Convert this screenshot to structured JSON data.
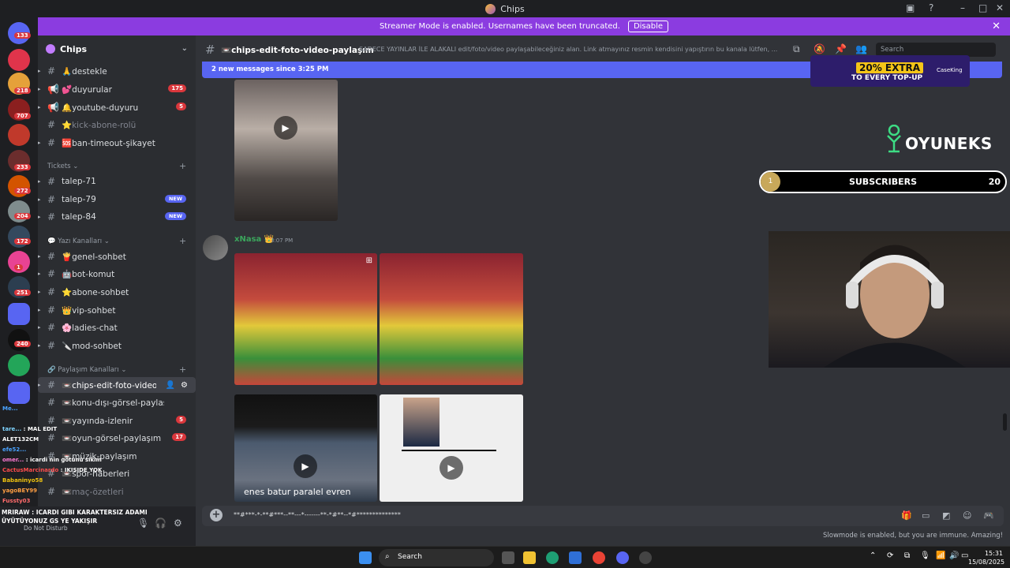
{
  "window": {
    "title": "Chips"
  },
  "banner": {
    "text": "Streamer Mode is enabled. Usernames have been truncated.",
    "button": "Disable",
    "color": "#8b3ce0"
  },
  "rail": {
    "badges": [
      "133",
      "218",
      "707",
      "233",
      "272",
      "204",
      "172",
      "1",
      "251",
      "240"
    ]
  },
  "server": {
    "name": "Chips"
  },
  "channels": [
    {
      "name": "🙏destekle",
      "badge": ""
    },
    {
      "name": "💕duyurular",
      "badge": "175"
    },
    {
      "name": "🔔youtube-duyuru",
      "badge": "5"
    },
    {
      "name": "⭐kick-abone-rolü",
      "badge": ""
    },
    {
      "name": "🆘ban-timeout-şikayet",
      "badge": ""
    }
  ],
  "categories": {
    "tickets": "Tickets",
    "yazi": "Yazı Kanalları",
    "paylasim": "Paylaşım Kanalları"
  },
  "tickets": [
    {
      "name": "talep-71",
      "badge": ""
    },
    {
      "name": "talep-79",
      "badge": "NEW"
    },
    {
      "name": "talep-84",
      "badge": "NEW"
    }
  ],
  "yazi_channels": [
    {
      "name": "🍟genel-sohbet"
    },
    {
      "name": "🤖bot-komut"
    },
    {
      "name": "⭐abone-sohbet"
    },
    {
      "name": "👑vip-sohbet"
    },
    {
      "name": "🌸ladies-chat"
    },
    {
      "name": "🔪mod-sohbet"
    }
  ],
  "paylasim_channels": [
    {
      "name": "📼chips-edit-foto-video-...",
      "badge": ""
    },
    {
      "name": "📼konu-dışı-görsel-paylaşım",
      "badge": ""
    },
    {
      "name": "📼yayında-izlenir",
      "badge": "5"
    },
    {
      "name": "📼oyun-görsel-paylaşım",
      "badge": "17"
    },
    {
      "name": "📼müzik-paylaşım",
      "badge": ""
    },
    {
      "name": "📼spor-haberleri",
      "badge": ""
    },
    {
      "name": "📼maç-özetleri",
      "badge": ""
    }
  ],
  "stream_chat": [
    {
      "user": "Me...",
      "text": ""
    },
    {
      "user": "tare...",
      "text": "MAL EDIT"
    },
    {
      "user": "ALET132CM",
      "text": ""
    },
    {
      "user": "efe52...",
      "text": ""
    },
    {
      "user": "omer...",
      "text": "icardi nin götünü sikim"
    },
    {
      "user": "CactusMarcinardo",
      "text": "IKISIDE YOK"
    },
    {
      "user": "Babaninyo58",
      "text": ""
    },
    {
      "user": "yagoBEY99",
      "text": ""
    },
    {
      "user": "Fussty03",
      "text": ""
    }
  ],
  "user_panel": {
    "line1": "MRIRAW : ICARDI GIBI KARAKTERSIZ ADAMI",
    "line2": "ÜYÜTÜYONUZ GS YE YAKIŞIR",
    "status": "Do Not Disturb"
  },
  "channel_header": {
    "name": "📼chips-edit-foto-video-paylaşım",
    "topic": "SADECE YAYINLAR İLE ALAKALI edit/foto/video paylaşabileceğiniz alan. Link atmayınız resmin kendisini yapıştırın bu kanala lütfen, ...",
    "search_placeholder": "Search"
  },
  "new_messages": "2 new messages since 3:25 PM",
  "message": {
    "author": "xNasa 👑",
    "time": "3:07 PM",
    "video_caption": "enes batur paralel evren"
  },
  "composer": {
    "text": "**#***-*-**#***--**---*-------**-*#**--*#**************"
  },
  "slowmode": "Slowmode is enabled, but you are immune. Amazing!",
  "overlay": {
    "brand": "OYUNEKS",
    "subscribers_label": "SUBSCRIBERS",
    "subscribers_current": "1",
    "subscribers_goal": "20",
    "ad_line1": "20% EXTRA",
    "ad_line2": "TO EVERY TOP-UP",
    "ad_brand": "CaseKing"
  },
  "taskbar": {
    "search": "Search",
    "time": "15:31",
    "date": "15/08/2025"
  }
}
